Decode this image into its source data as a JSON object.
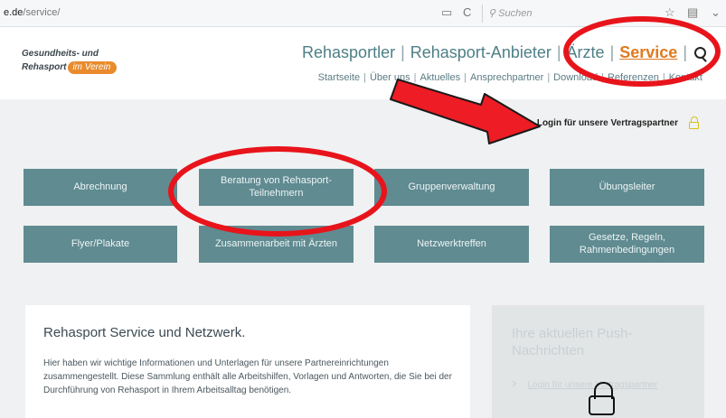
{
  "browser": {
    "url_host": "e.de",
    "url_path": "/service/",
    "search_placeholder": "Suchen",
    "reload_glyph": "C",
    "reader_glyph": "▭"
  },
  "logo": {
    "line1": "Gesundheits- und",
    "line2": "Rehasport",
    "badge": "im Verein"
  },
  "mainnav": {
    "items": [
      "Rehasportler",
      "Rehasport-Anbieter",
      "Ärzte",
      "Service"
    ],
    "active": "Service",
    "separator": "|"
  },
  "subnav": {
    "items": [
      "Startseite",
      "Über uns",
      "Aktuelles",
      "Ansprechpartner",
      "Download",
      "Referenzen",
      "Kontakt"
    ]
  },
  "login": {
    "label": "Login für unsere Vertragspartner"
  },
  "tiles": [
    "Abrechnung",
    "Beratung von Rehasport-Teilnehmern",
    "Gruppenverwaltung",
    "Übungsleiter",
    "Flyer/Plakate",
    "Zusammenarbeit mit Ärzten",
    "Netzwerktreffen",
    "Gesetze, Regeln, Rahmenbedingungen"
  ],
  "intro": {
    "title": "Rehasport Service und Netzwerk.",
    "text": "Hier haben wir wichtige Informationen und Unterlagen für unsere Partnereinrichtungen zusammengestellt. Diese Sammlung enthält alle Arbeitshilfen, Vorlagen und Antworten, die Sie bei der Durchführung von Rehasport in Ihrem Arbeitsalltag benötigen."
  },
  "push": {
    "title": "Ihre aktuellen Push-Nachrichten",
    "link": "Login für unsere Vertragspartner"
  },
  "colors": {
    "tile": "#5f8b91",
    "accent": "#e07a1f",
    "annotation_red": "#e8141b"
  },
  "icons": [
    "search-icon",
    "lock-icon",
    "chevron-right-icon",
    "reload-icon",
    "reader-icon",
    "star-icon",
    "bookmark-icon",
    "pocket-icon"
  ]
}
